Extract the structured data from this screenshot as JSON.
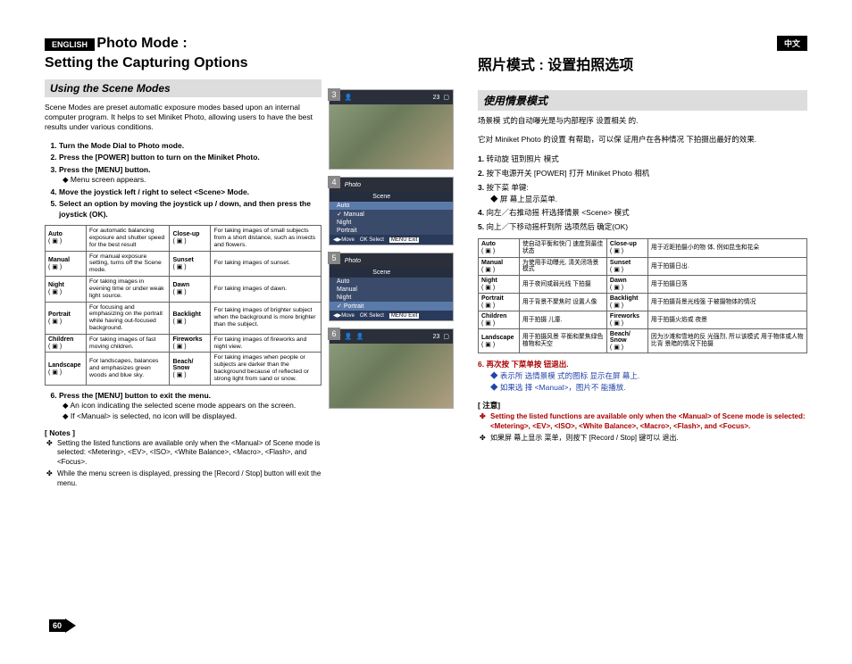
{
  "badge_en": "ENGLISH",
  "badge_cn": "中文",
  "title_en_line1": "Photo Mode :",
  "title_en_line2": "Setting the Capturing Options",
  "title_cn": "照片模式 : 设置拍照选项",
  "section_en": "Using the Scene Modes",
  "section_cn": "使用情景模式",
  "intro_en": "Scene Modes are preset automatic exposure modes based upon an internal computer program. It helps to set Miniket Photo, allowing users to have the best results under various conditions.",
  "intro_cn_1": "场景模 式的自动曝光是与内部程序 设置相关 的.",
  "intro_cn_2": "它对 Miniket Photo 的设置 有帮助，可以保 证用户在各种情况 下拍摄出最好的效果.",
  "steps_en": [
    "Turn the Mode Dial to Photo mode.",
    "Press the [POWER] button to turn on the Miniket Photo.",
    "Press the [MENU] button.",
    "Move the joystick left / right to select <Scene> Mode.",
    "Select an option by moving the joystick up / down, and then press the joystick (OK)."
  ],
  "sub3_en": "Menu screen appears.",
  "step6_en": "Press the [MENU] button to exit the menu.",
  "sub6a_en": "An icon indicating the selected scene mode appears on the screen.",
  "sub6b_en": "If <Manual> is selected, no icon will be displayed.",
  "notes_title_en": "[ Notes ]",
  "note1_en": "Setting the listed functions are available only when the <Manual> of Scene mode is selected: <Metering>, <EV>, <ISO>, <White Balance>, <Macro>, <Flash>, and <Focus>.",
  "note2_en": "While the menu screen is displayed, pressing the [Record / Stop] button will exit the menu.",
  "steps_cn": [
    "转动旋 钮到照片 模式",
    "按下电源开关 [POWER] 打开 Miniket Photo 相机",
    "按下菜 单键:",
    "向左／右推动摇 杆选择情景 <Scene> 模式",
    "向上／下移动摇杆到所 选项然后 确定(OK)"
  ],
  "sub3_cn": "屏 幕上显示菜单.",
  "step6_cn": "再次按 下菜单按 钮退出.",
  "sub6a_cn": "表示所 选情景模 式的图标 显示在屏 幕上.",
  "sub6b_cn": "如果选 择 <Manual>，图片不 能播放.",
  "notes_title_cn": "[ 注意]",
  "note1_cn": "Setting the listed functions are available only when the <Manual> of Scene mode is selected: <Metering>, <EV>, <ISO>, <White Balance>, <Macro>, <Flash>, and <Focus>.",
  "note2_cn": "如果屏 幕上显示 菜单，则按下 [Record / Stop] 键可以 退出.",
  "scene_table": [
    {
      "l1": "Auto",
      "d1": "For automatic balancing exposure and shutter speed for the best result",
      "l2": "Close-up",
      "d2": "For taking images of small subjects from a short distance, such as insects and flowers."
    },
    {
      "l1": "Manual",
      "d1": "For manual exposure setting, turns off the Scene mode.",
      "l2": "Sunset",
      "d2": "For taking images of sunset."
    },
    {
      "l1": "Night",
      "d1": "For taking images in evening time or under weak light source.",
      "l2": "Dawn",
      "d2": "For taking images of dawn."
    },
    {
      "l1": "Portrait",
      "d1": "For focusing and emphasizing on the portrait while having out-focused background.",
      "l2": "Backlight",
      "d2": "For taking images of brighter subject when the background is more brighter than the subject."
    },
    {
      "l1": "Children",
      "d1": "For taking images of fast moving children.",
      "l2": "Fireworks",
      "d2": "For taking images of fireworks and night view."
    },
    {
      "l1": "Landscape",
      "d1": "For landscapes, balances and emphasizes green woods and blue sky.",
      "l2": "Beach/ Snow",
      "d2": "For taking images when people or subjects are darker than the background because of reflected or strong light from sand or snow."
    }
  ],
  "scene_table_cn": [
    {
      "l1": "Auto",
      "d1": "使自动平衡和快门 速度到最佳状态",
      "l2": "Close-up",
      "d2": "用于近距拍摄小的物 体, 例如昆虫和花朵"
    },
    {
      "l1": "Manual",
      "d1": "为使用手动曝光, 清关闭场景模式",
      "l2": "Sunset",
      "d2": "用于拍摄日出."
    },
    {
      "l1": "Night",
      "d1": "用于夜间或弱光线 下拍摄",
      "l2": "Dawn",
      "d2": "用于拍摄日落"
    },
    {
      "l1": "Portrait",
      "d1": "用于背景不聚焦时 设置人像",
      "l2": "Backlight",
      "d2": "用于拍摄背景光线强 于被摄物体的情况"
    },
    {
      "l1": "Children",
      "d1": "用于拍摄 儿童.",
      "l2": "Fireworks",
      "d2": "用于拍摄火焰或 夜景"
    },
    {
      "l1": "Landscape",
      "d1": "用于拍摄风景 平衡和聚焦绿色 植物和天空",
      "l2": "Beach/ Snow",
      "d2": "因为沙滩和雪地的反 光强烈, 所以该模式 用于物体或人物比背 景暗的情况下拍摄"
    }
  ],
  "ss_labels": {
    "counter": "23",
    "scene": "Scene",
    "photo": "Photo",
    "auto": "Auto",
    "manual": "Manual",
    "night": "Night",
    "portrait": "Portrait",
    "move": "Move",
    "ok_select": "OK Select",
    "menu_exit": "MENU Exit"
  },
  "page_number": "60"
}
